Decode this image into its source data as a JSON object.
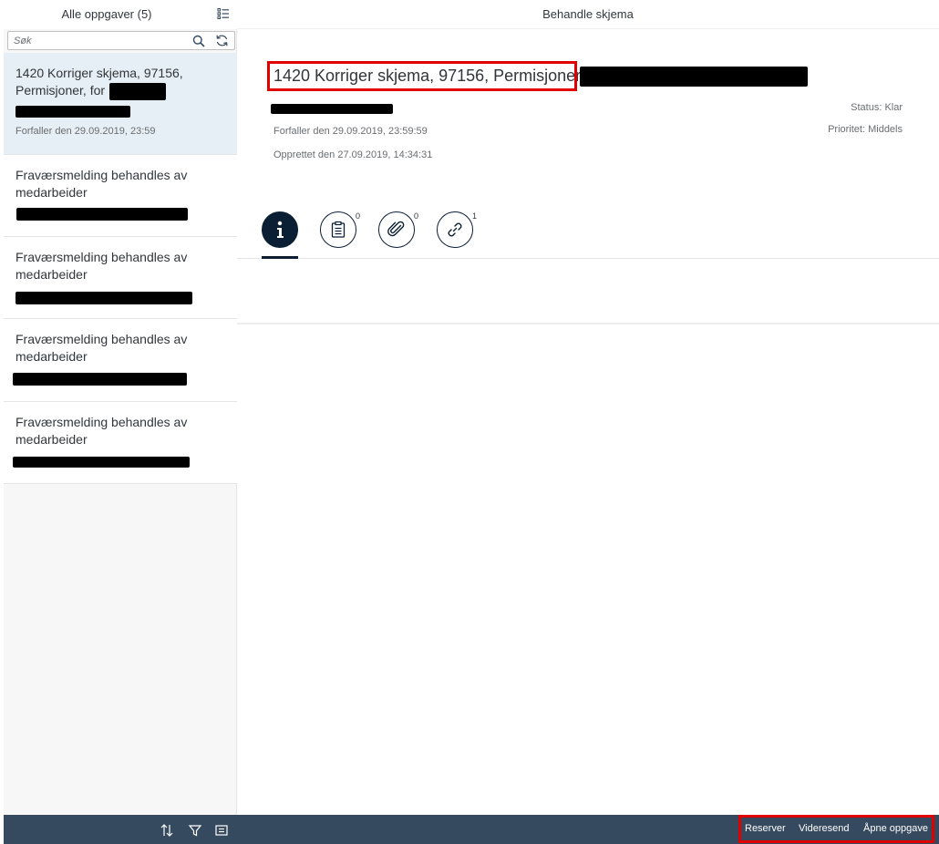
{
  "master": {
    "title": "Alle oppgaver (5)",
    "search_placeholder": "Søk",
    "items": [
      {
        "title": "1420 Korriger skjema, 97156, Permisjoner, for",
        "due": "Forfaller den 29.09.2019, 23:59",
        "selected": true
      },
      {
        "title": "Fraværsmelding behandles av medarbeider"
      },
      {
        "title": "Fraværsmelding behandles av medarbeider"
      },
      {
        "title": "Fraværsmelding behandles av medarbeider"
      },
      {
        "title": "Fraværsmelding behandles av medarbeider"
      }
    ]
  },
  "detail": {
    "title": "Behandle skjema",
    "object_title": "1420 Korriger skjema, 97156, Permisjoner, f",
    "due": "Forfaller den 29.09.2019, 23:59:59",
    "created": "Opprettet den 27.09.2019, 14:34:31",
    "status": "Status: Klar",
    "priority": "Prioritet: Middels",
    "tabs": [
      {
        "icon": "info-icon",
        "count": ""
      },
      {
        "icon": "notes-icon",
        "count": "0"
      },
      {
        "icon": "attachment-icon",
        "count": "0"
      },
      {
        "icon": "link-icon",
        "count": "1"
      }
    ]
  },
  "footer": {
    "reserve": "Reserver",
    "forward": "Videresend",
    "open": "Åpne oppgave"
  },
  "colors": {
    "footer_bg": "#354a5f",
    "selected_bg": "#e5eff5",
    "highlight": "#e00000",
    "tab_active": "#0a1f33"
  }
}
